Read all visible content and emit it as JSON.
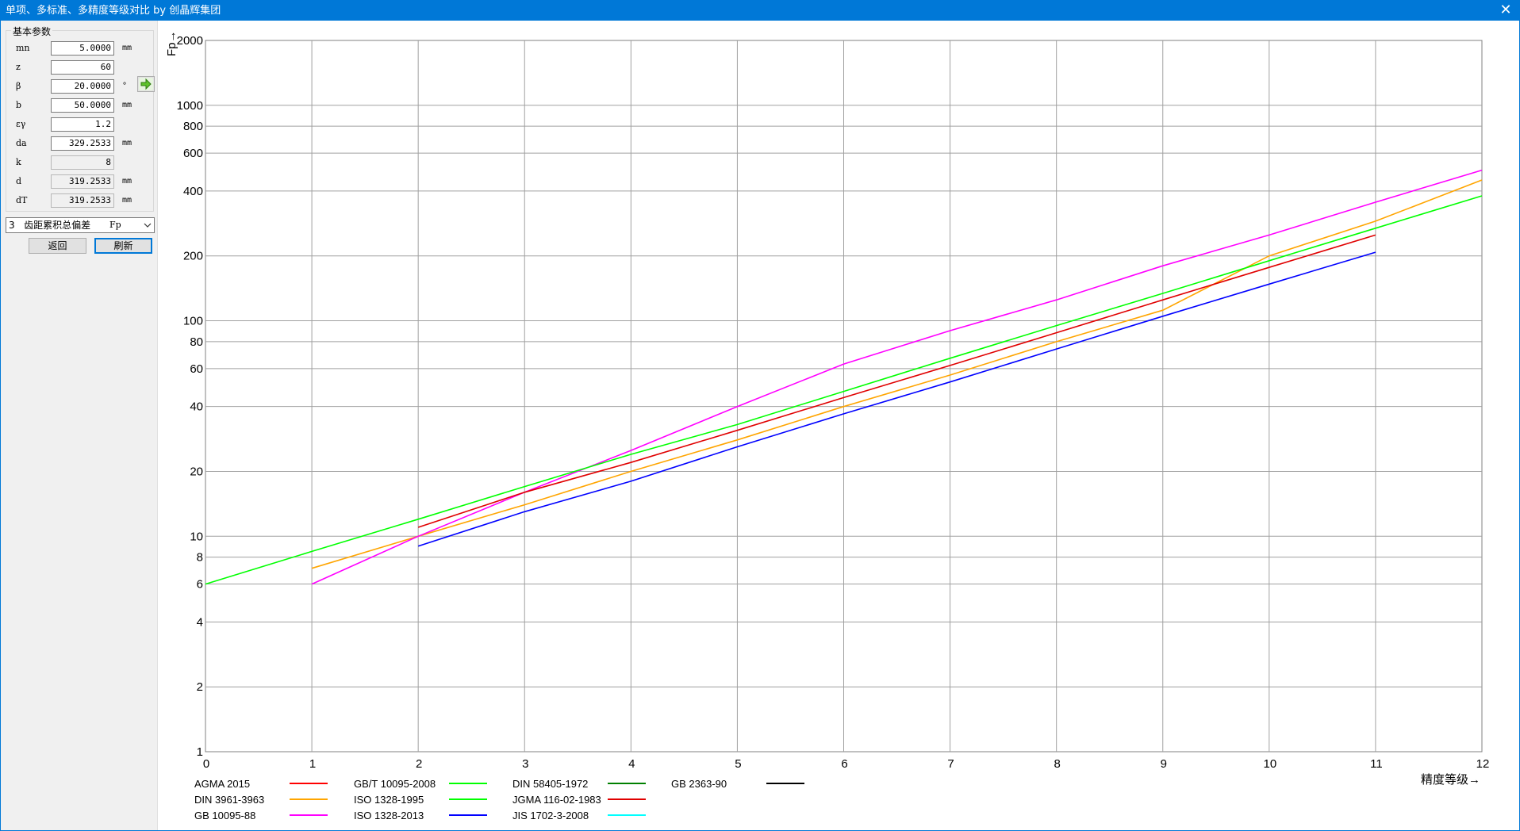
{
  "window": {
    "title": "单项、多标准、多精度等级对比 by 创晶辉集团",
    "close": "✕"
  },
  "params": {
    "group_title": "基本参数",
    "rows": [
      {
        "label": "mn",
        "value": "5.0000",
        "unit": "mm",
        "readonly": false
      },
      {
        "label": "z",
        "value": "60",
        "unit": "",
        "readonly": false
      },
      {
        "label": "β",
        "value": "20.0000",
        "unit": "°",
        "readonly": false
      },
      {
        "label": "b",
        "value": "50.0000",
        "unit": "mm",
        "readonly": false
      },
      {
        "label": "εγ",
        "value": "1.2",
        "unit": "",
        "readonly": false
      },
      {
        "label": "da",
        "value": "329.2533",
        "unit": "mm",
        "readonly": false
      },
      {
        "label": "k",
        "value": "8",
        "unit": "",
        "readonly": true
      },
      {
        "label": "d",
        "value": "319.2533",
        "unit": "mm",
        "readonly": true
      },
      {
        "label": "dT",
        "value": "319.2533",
        "unit": "mm",
        "readonly": true
      }
    ]
  },
  "deviation_select": {
    "index": "3",
    "label": "齿距累积总偏差",
    "code": "Fp"
  },
  "buttons": {
    "back": "返回",
    "refresh": "刷新"
  },
  "colors": {
    "accent": "#0078d7"
  },
  "chart_data": {
    "type": "line",
    "ylabel": "Fp→",
    "xlabel": "精度等级→",
    "y_scale": "log",
    "xlim": [
      0,
      12
    ],
    "ylim": [
      1,
      2000
    ],
    "x_ticks": [
      "0",
      "1",
      "2",
      "3",
      "4",
      "5",
      "6",
      "7",
      "8",
      "9",
      "10",
      "11",
      "12"
    ],
    "y_ticks": [
      "1",
      "2",
      "4",
      "6",
      "8",
      "10",
      "20",
      "40",
      "60",
      "80",
      "100",
      "200",
      "400",
      "600",
      "800",
      "1000",
      "2000"
    ],
    "grid": true,
    "legend_position": "bottom",
    "series": [
      {
        "name": "AGMA 2015",
        "color": "#ff0000",
        "points": []
      },
      {
        "name": "DIN 3961-3963",
        "color": "#ffa500",
        "points": [
          [
            1,
            7.1
          ],
          [
            2,
            10
          ],
          [
            3,
            14
          ],
          [
            4,
            20
          ],
          [
            5,
            28
          ],
          [
            6,
            40
          ],
          [
            7,
            56
          ],
          [
            8,
            80
          ],
          [
            9,
            112
          ],
          [
            10,
            200
          ],
          [
            11,
            290
          ],
          [
            12,
            450
          ]
        ]
      },
      {
        "name": "GB 10095-88",
        "color": "#ff00ff",
        "points": [
          [
            1,
            6
          ],
          [
            2,
            10
          ],
          [
            3,
            16
          ],
          [
            4,
            25
          ],
          [
            5,
            40
          ],
          [
            6,
            63
          ],
          [
            7,
            90
          ],
          [
            8,
            125
          ],
          [
            9,
            180
          ],
          [
            10,
            250
          ],
          [
            11,
            355
          ],
          [
            12,
            500
          ]
        ]
      },
      {
        "name": "GB/T 10095-2008",
        "color": "#00ff00",
        "points": []
      },
      {
        "name": "ISO 1328-1995",
        "color": "#00ff00",
        "points": [
          [
            0,
            6
          ],
          [
            1,
            8.5
          ],
          [
            2,
            12
          ],
          [
            3,
            17
          ],
          [
            4,
            24
          ],
          [
            5,
            33
          ],
          [
            6,
            47
          ],
          [
            7,
            67
          ],
          [
            8,
            95
          ],
          [
            9,
            134
          ],
          [
            10,
            190
          ],
          [
            11,
            269
          ],
          [
            12,
            380
          ]
        ]
      },
      {
        "name": "ISO 1328-2013",
        "color": "#0000ff",
        "points": [
          [
            2,
            9
          ],
          [
            3,
            13
          ],
          [
            4,
            18
          ],
          [
            5,
            26
          ],
          [
            6,
            37
          ],
          [
            7,
            52
          ],
          [
            8,
            74
          ],
          [
            9,
            105
          ],
          [
            10,
            148
          ],
          [
            11,
            208
          ]
        ]
      },
      {
        "name": "DIN 58405-1972",
        "color": "#008000",
        "points": []
      },
      {
        "name": "JGMA 116-02-1983",
        "color": "#e00000",
        "points": [
          [
            2,
            11
          ],
          [
            3,
            16
          ],
          [
            4,
            22
          ],
          [
            5,
            31
          ],
          [
            6,
            44
          ],
          [
            7,
            62
          ],
          [
            8,
            88
          ],
          [
            9,
            125
          ],
          [
            10,
            177
          ],
          [
            11,
            250
          ]
        ]
      },
      {
        "name": "JIS 1702-3-2008",
        "color": "#00ffff",
        "points": []
      },
      {
        "name": "GB 2363-90",
        "color": "#000000",
        "points": []
      }
    ]
  }
}
